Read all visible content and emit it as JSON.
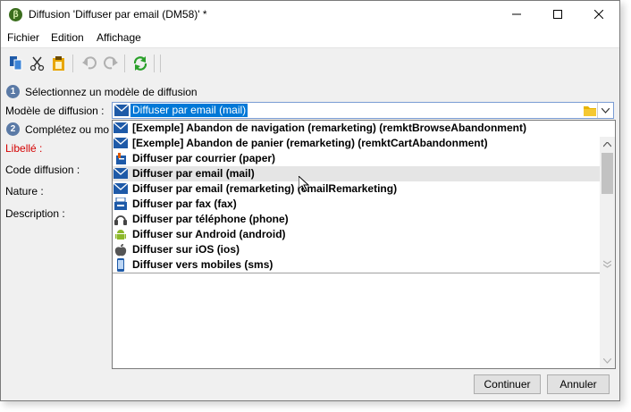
{
  "window": {
    "title": "Diffusion 'Diffuser par email (DM58)' *"
  },
  "menu": {
    "items": [
      {
        "label": "Fichier"
      },
      {
        "label": "Edition"
      },
      {
        "label": "Affichage"
      }
    ]
  },
  "steps": {
    "step1": {
      "number": "1",
      "label": "Sélectionnez un modèle de diffusion"
    },
    "step2": {
      "number": "2",
      "label": "Complétez ou mo"
    }
  },
  "form": {
    "model_label": "Modèle de diffusion :",
    "model_selected": "Diffuser par email (mail)",
    "libelle_label": "Libellé :",
    "code_label": "Code diffusion :",
    "nature_label": "Nature :",
    "description_label": "Description :"
  },
  "dropdown": {
    "items": [
      {
        "label": "[Exemple] Abandon de navigation (remarketing) (remktBrowseAbandonment)",
        "icon": "email-icon"
      },
      {
        "label": "[Exemple] Abandon de panier (remarketing) (remktCartAbandonment)",
        "icon": "email-icon"
      },
      {
        "label": "Diffuser par courrier (paper)",
        "icon": "mail-letter-icon"
      },
      {
        "label": "Diffuser par email (mail)",
        "icon": "email-icon"
      },
      {
        "label": "Diffuser par email (remarketing) (emailRemarketing)",
        "icon": "email-icon"
      },
      {
        "label": "Diffuser par fax (fax)",
        "icon": "fax-icon"
      },
      {
        "label": "Diffuser par téléphone (phone)",
        "icon": "phone-icon"
      },
      {
        "label": "Diffuser sur Android (android)",
        "icon": "android-icon"
      },
      {
        "label": "Diffuser sur iOS (ios)",
        "icon": "apple-icon"
      },
      {
        "label": "Diffuser vers mobiles (sms)",
        "icon": "mobile-icon"
      }
    ]
  },
  "buttons": {
    "continue": "Continuer",
    "cancel": "Annuler"
  },
  "colors": {
    "selection": "#0078d7",
    "required": "#d40000",
    "step_badge": "#5b7aa6",
    "email_icon": "#1e5aa8"
  }
}
